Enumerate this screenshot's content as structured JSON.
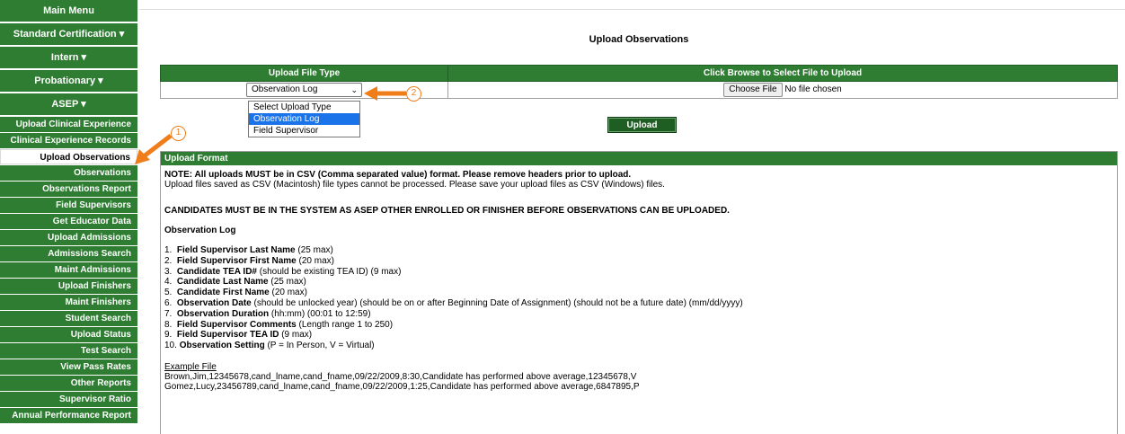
{
  "sidebar": {
    "heads": [
      "Main Menu",
      "Standard Certification ▾",
      "Intern ▾",
      "Probationary ▾",
      "ASEP ▾"
    ],
    "items": [
      "Upload Clinical Experience",
      "Clinical Experience Records",
      "Upload Observations",
      "Observations",
      "Observations Report",
      "Field Supervisors",
      "Get Educator Data",
      "Upload Admissions",
      "Admissions Search",
      "Maint Admissions",
      "Upload Finishers",
      "Maint Finishers",
      "Student Search",
      "Upload Status",
      "Test Search",
      "View Pass Rates",
      "Other Reports",
      "Supervisor Ratio",
      "Annual Performance Report"
    ],
    "active_item": "Upload Observations"
  },
  "page": {
    "title": "Upload Observations"
  },
  "upload_table": {
    "col1": "Upload File Type",
    "col2": "Click Browse to Select File to Upload",
    "select_value": "Observation Log",
    "options": [
      "Select Upload Type",
      "Observation Log",
      "Field Supervisor"
    ],
    "choose_file": "Choose File",
    "no_file": "No file chosen"
  },
  "upload_button": "Upload",
  "annotations": {
    "badge1": "1",
    "badge2": "2",
    "color": "#ef7d1a"
  },
  "format": {
    "header": "Upload Format",
    "note_bold": "NOTE: All uploads MUST be in CSV (Comma separated value) format. Please remove headers prior to upload.",
    "note": "Upload files saved as CSV (Macintosh) file types cannot be processed. Please save your upload files as CSV (Windows) files.",
    "candidates": "CANDIDATES MUST BE IN THE SYSTEM AS ASEP OTHER ENROLLED OR FINISHER BEFORE OBSERVATIONS CAN BE UPLOADED.",
    "obs_log_title": "Observation Log",
    "fields": [
      {
        "n": "1.",
        "b": "Field Supervisor Last Name",
        "t": " (25 max)"
      },
      {
        "n": "2.",
        "b": "Field Supervisor First Name",
        "t": " (20 max)"
      },
      {
        "n": "3.",
        "b": "Candidate TEA ID#",
        "t": " (should be existing TEA ID) (9 max)"
      },
      {
        "n": "4.",
        "b": "Candidate Last Name",
        "t": " (25 max)"
      },
      {
        "n": "5.",
        "b": "Candidate First Name",
        "t": " (20 max)"
      },
      {
        "n": "6.",
        "b": "Observation Date",
        "t": " (should be unlocked year) (should be on or after Beginning Date of Assignment) (should not be a future date) (mm/dd/yyyy)"
      },
      {
        "n": "7.",
        "b": "Observation Duration",
        "t": " (hh:mm) (00:01 to 12:59)"
      },
      {
        "n": "8.",
        "b": "Field Supervisor Comments",
        "t": " (Length range 1 to 250)"
      },
      {
        "n": "9.",
        "b": "Field Supervisor TEA ID",
        "t": " (9 max)"
      },
      {
        "n": "10.",
        "b": "Observation Setting",
        "t": " (P = In Person, V = Virtual)"
      }
    ],
    "example_title": "Example File",
    "example_lines": [
      "Brown,Jim,12345678,cand_lname,cand_fname,09/22/2009,8:30,Candidate has performed above average,12345678,V",
      "Gomez,Lucy,23456789,cand_lname,cand_fname,09/22/2009,1:25,Candidate has performed above average,6847895,P"
    ]
  }
}
